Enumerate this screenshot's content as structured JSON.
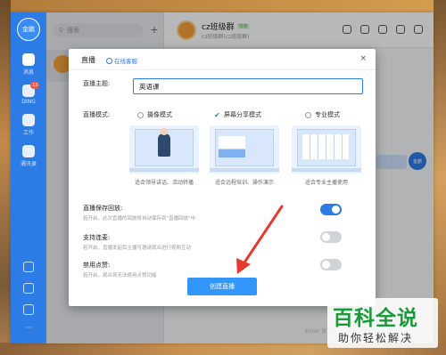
{
  "sidebar": {
    "avatar": "金鹏",
    "items": [
      {
        "label": "消息",
        "icon": "message-icon",
        "badge": ""
      },
      {
        "label": "DING",
        "icon": "ding-icon",
        "badge": "13"
      },
      {
        "label": "工作",
        "icon": "work-icon",
        "badge": ""
      },
      {
        "label": "通讯录",
        "icon": "contacts-icon",
        "badge": ""
      }
    ]
  },
  "convlist": {
    "search_placeholder": "搜索",
    "add": "+"
  },
  "chat": {
    "group_name": "cz班级群",
    "group_tag": "班级",
    "group_subtitle": "cz班级群(cz班级群)",
    "my_avatar": "金鹏",
    "enter_hint": "Enter 发送"
  },
  "modal": {
    "title": "直播",
    "service": "在线客服",
    "close": "×",
    "topic_label": "直播主题:",
    "topic_value": "英语课",
    "mode_label": "直播模式:",
    "modes": [
      {
        "label": "摄像模式",
        "selected": false,
        "desc": "适合领导讲话、活动转播"
      },
      {
        "label": "屏幕分享模式",
        "selected": true,
        "desc": "适合远程培训、操作演示"
      },
      {
        "label": "专业模式",
        "selected": false,
        "desc": "适合专业主播使用"
      }
    ],
    "settings": [
      {
        "title": "直播保存回放:",
        "desc": "若开启，此次直播的回放将自动保存到\"直播回放\"中",
        "on": true
      },
      {
        "title": "支持连麦:",
        "desc": "若开启，直播发起后主播可邀请观众进行视频互动",
        "on": false
      },
      {
        "title": "禁用点赞:",
        "desc": "若开启，观众将无法使用点赞功能",
        "on": false
      }
    ],
    "create_button": "创建直播"
  },
  "watermark": {
    "big": "百科全说",
    "small": "助你轻松解决"
  },
  "colors": {
    "accent": "#2d7be5",
    "button": "#3296fa",
    "watermark_green": "#1a9b3a"
  }
}
